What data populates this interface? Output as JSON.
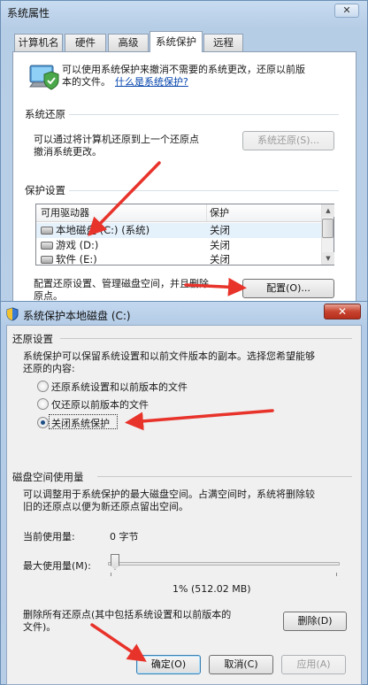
{
  "system_properties": {
    "title": "系统属性",
    "close_glyph": "✕",
    "tabs": [
      "计算机名",
      "硬件",
      "高级",
      "系统保护",
      "远程"
    ],
    "active_tab": "系统保护",
    "intro_line1": "可以使用系统保护来撤消不需要的系统更改，还原以前版",
    "intro_line2": "本的文件。",
    "intro_link": "什么是系统保护?",
    "restore": {
      "heading": "系统还原",
      "desc_line1": "可以通过将计算机还原到上一个还原点",
      "desc_line2": "撤消系统更改。",
      "button": "系统还原(S)..."
    },
    "protection": {
      "heading": "保护设置",
      "col_drive": "可用驱动器",
      "col_protection": "保护",
      "drives": [
        {
          "name": "本地磁盘 (C:) (系统)",
          "status": "关闭"
        },
        {
          "name": "游戏 (D:)",
          "status": "关闭"
        },
        {
          "name": "软件 (E:)",
          "status": "关闭"
        }
      ],
      "config_desc_line1": "配置还原设置、管理磁盘空间，并且删除",
      "config_desc_line2": "原点。",
      "config_button": "配置(O)..."
    }
  },
  "protect_dialog": {
    "title": "系统保护本地磁盘 (C:)",
    "close_glyph": "✕",
    "restore_settings": {
      "heading": "还原设置",
      "desc_line1": "系统保护可以保留系统设置和以前文件版本的副本。选择您希望能够",
      "desc_line2": "还原的内容:",
      "options": [
        "还原系统设置和以前版本的文件",
        "仅还原以前版本的文件",
        "关闭系统保护"
      ],
      "selected_index": 2
    },
    "disk_usage": {
      "heading": "磁盘空间使用量",
      "desc_line1": "可以调整用于系统保护的最大磁盘空间。占满空间时，系统将删除较",
      "desc_line2": "旧的还原点以便为新还原点留出空间。",
      "current_label": "当前使用量:",
      "current_value": "0 字节",
      "max_label": "最大使用量(M):",
      "slider_percent": 1,
      "max_value_text": "1% (512.02 MB)"
    },
    "delete": {
      "desc_line1": "删除所有还原点(其中包括系统设置和以前版本的",
      "desc_line2": "文件)。",
      "button": "删除(D)"
    },
    "buttons": {
      "ok": "确定(O)",
      "cancel": "取消(C)",
      "apply": "应用(A)"
    }
  },
  "colors": {
    "annotation_arrow": "#e8332b",
    "link": "#0645ad",
    "title_bar": "#b9cfe7"
  }
}
